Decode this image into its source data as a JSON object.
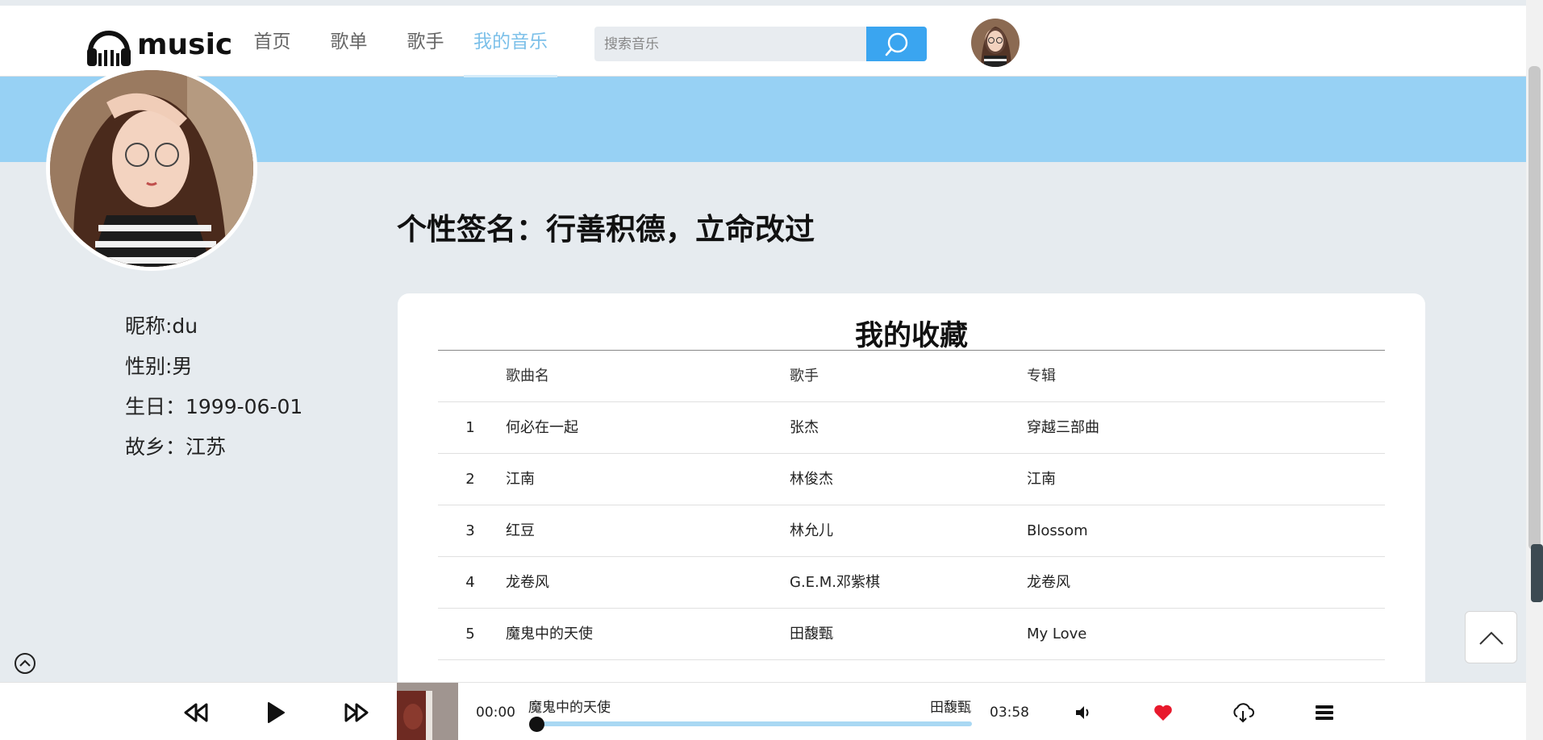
{
  "header": {
    "logo_text": "music",
    "nav": [
      {
        "label": "首页",
        "active": false
      },
      {
        "label": "歌单",
        "active": false
      },
      {
        "label": "歌手",
        "active": false
      },
      {
        "label": "我的音乐",
        "active": true
      }
    ],
    "search": {
      "placeholder": "搜索音乐",
      "value": ""
    }
  },
  "profile": {
    "signature": "个性签名：行善积德，立命改过",
    "nickname": "昵称:du",
    "gender": "性别:男",
    "birthday": "生日：1999-06-01",
    "hometown": "故乡：江苏"
  },
  "favorites": {
    "title": "我的收藏",
    "columns": [
      "",
      "歌曲名",
      "歌手",
      "专辑"
    ],
    "rows": [
      {
        "index": "1",
        "song": "何必在一起",
        "singer": "张杰",
        "album": "穿越三部曲"
      },
      {
        "index": "2",
        "song": "江南",
        "singer": "林俊杰",
        "album": "江南"
      },
      {
        "index": "3",
        "song": "红豆",
        "singer": "林允儿",
        "album": "Blossom"
      },
      {
        "index": "4",
        "song": "龙卷风",
        "singer": "G.E.M.邓紫棋",
        "album": "龙卷风"
      },
      {
        "index": "5",
        "song": "魔鬼中的天使",
        "singer": "田馥甄",
        "album": "My Love"
      }
    ]
  },
  "player": {
    "current_time": "00:00",
    "duration": "03:58",
    "track_title": "魔鬼中的天使",
    "track_artist": "田馥甄",
    "progress": 0,
    "colors": {
      "accent": "#3aa5f0",
      "banner": "#97d1f4",
      "heart": "#e8192c",
      "nav_active": "#7cc0e9"
    },
    "icons": [
      "prev-icon",
      "play-icon",
      "next-icon",
      "volume-icon",
      "heart-icon",
      "download-icon",
      "playlist-icon"
    ]
  }
}
